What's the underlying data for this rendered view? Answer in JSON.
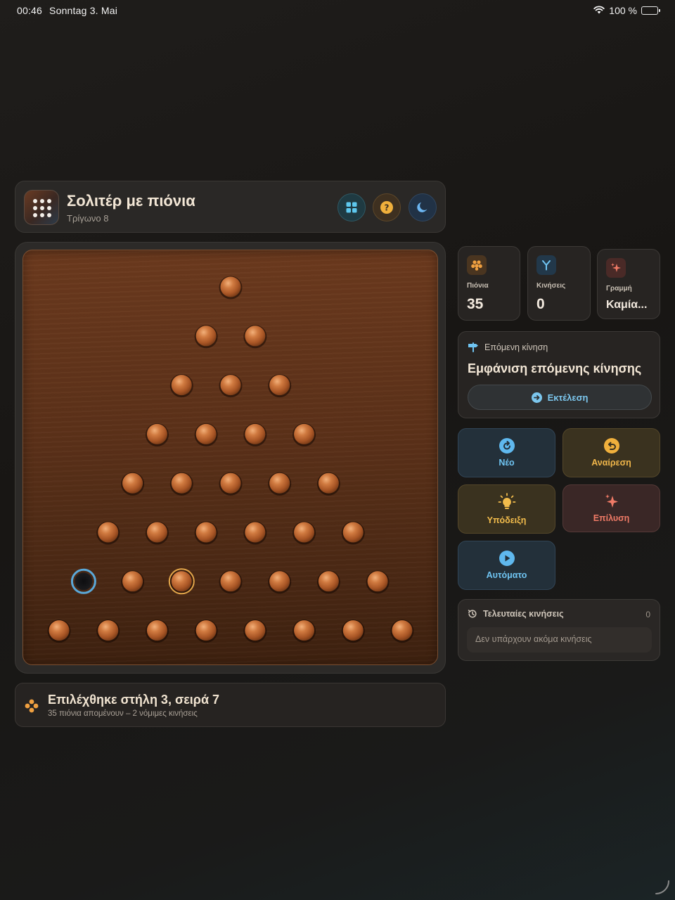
{
  "status_bar": {
    "time": "00:46",
    "date": "Sonntag 3. Mai",
    "battery": "100 %"
  },
  "header": {
    "title": "Σολιτέρ με πιόνια",
    "subtitle": "Τρίγωνο 8",
    "buttons": [
      "grid-icon",
      "help-icon",
      "moon-icon"
    ]
  },
  "board": {
    "rows": 8,
    "pegs": [
      [
        1
      ],
      [
        1,
        1
      ],
      [
        1,
        1,
        1
      ],
      [
        1,
        1,
        1,
        1
      ],
      [
        1,
        1,
        1,
        1,
        1
      ],
      [
        1,
        1,
        1,
        1,
        1,
        1
      ],
      [
        0,
        1,
        1,
        1,
        1,
        1,
        1
      ],
      [
        1,
        1,
        1,
        1,
        1,
        1,
        1,
        1
      ]
    ],
    "selected": {
      "row": 7,
      "col": 3
    },
    "empty_target": {
      "row": 7,
      "col": 1
    },
    "colors": {
      "peg": "#c06a33",
      "selected_ring": "#e3a64a",
      "target_ring": "#5aa8d8"
    }
  },
  "status": {
    "main": "Επιλέχθηκε στήλη 3, σειρά 7",
    "sub": "35 πιόνια απομένουν – 2 νόμιμες κινήσεις"
  },
  "stats": [
    {
      "label": "Πιόνια",
      "value": "35",
      "icon": "pegs-icon",
      "color": "#f0a040"
    },
    {
      "label": "Κινήσεις",
      "value": "0",
      "icon": "branch-icon",
      "color": "#6fc4f2"
    },
    {
      "label": "Γραμμή",
      "value": "Καμία...",
      "icon": "sparkle-icon",
      "color": "#ef7a66"
    }
  ],
  "next_move": {
    "heading": "Επόμενη κίνηση",
    "text": "Εμφάνιση επόμενης κίνησης",
    "button": "Εκτέλεση"
  },
  "actions": {
    "new": "Νέο",
    "undo": "Αναίρεση",
    "hint": "Υπόδειξη",
    "solve": "Επίλυση",
    "auto": "Αυτόματο"
  },
  "recent": {
    "heading": "Τελευταίες κινήσεις",
    "count": "0",
    "empty": "Δεν υπάρχουν ακόμα κινήσεις"
  }
}
